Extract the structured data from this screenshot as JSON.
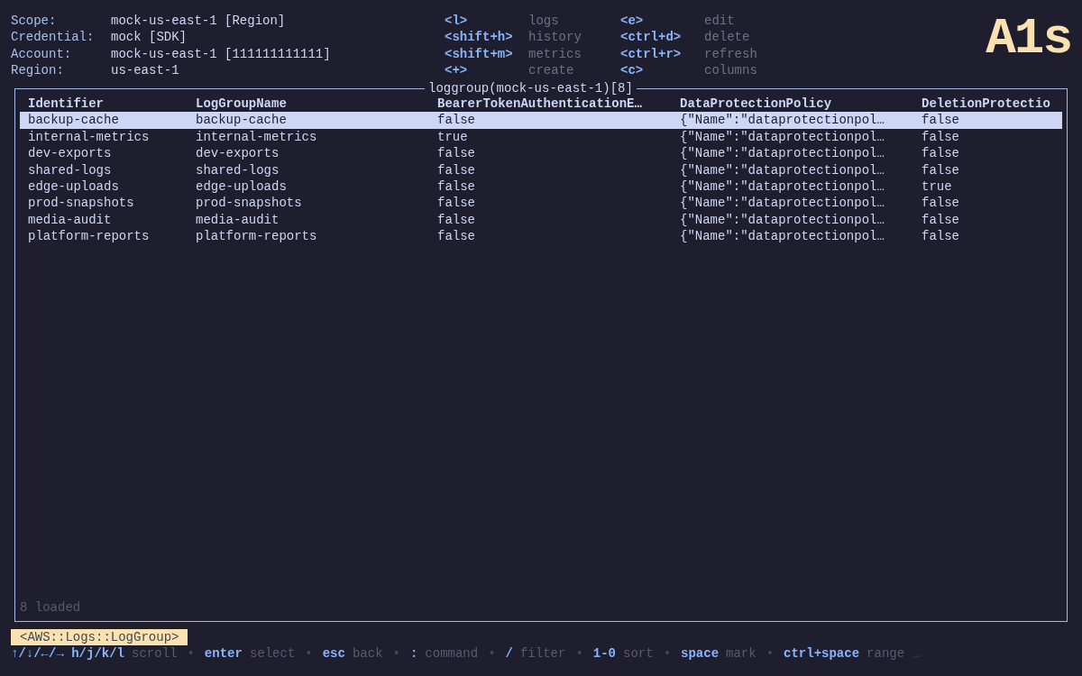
{
  "context": [
    {
      "label": "Scope:",
      "value": "mock-us-east-1 [Region]"
    },
    {
      "label": "Credential:",
      "value": "mock [SDK]"
    },
    {
      "label": "Account:",
      "value": "mock-us-east-1 [111111111111]"
    },
    {
      "label": "Region:",
      "value": "us-east-1"
    }
  ],
  "shortcuts": [
    {
      "key": "<l>",
      "action": "logs"
    },
    {
      "key": "<shift+h>",
      "action": "history"
    },
    {
      "key": "<shift+m>",
      "action": "metrics"
    },
    {
      "key": "<+>",
      "action": "create"
    },
    {
      "key": "<e>",
      "action": "edit"
    },
    {
      "key": "<ctrl+d>",
      "action": "delete"
    },
    {
      "key": "<ctrl+r>",
      "action": "refresh"
    },
    {
      "key": "<c>",
      "action": "columns"
    }
  ],
  "logo": "A1s",
  "table": {
    "title": "loggroup(mock-us-east-1)[8]",
    "columns": [
      "Identifier",
      "LogGroupName",
      "BearerTokenAuthenticationE…",
      "DataProtectionPolicy",
      "DeletionProtectio"
    ],
    "rows": [
      {
        "selected": true,
        "cells": [
          "backup-cache",
          "backup-cache",
          "false",
          "{\"Name\":\"dataprotectionpol…",
          "false"
        ]
      },
      {
        "selected": false,
        "cells": [
          "internal-metrics",
          "internal-metrics",
          "true",
          "{\"Name\":\"dataprotectionpol…",
          "false"
        ]
      },
      {
        "selected": false,
        "cells": [
          "dev-exports",
          "dev-exports",
          "false",
          "{\"Name\":\"dataprotectionpol…",
          "false"
        ]
      },
      {
        "selected": false,
        "cells": [
          "shared-logs",
          "shared-logs",
          "false",
          "{\"Name\":\"dataprotectionpol…",
          "false"
        ]
      },
      {
        "selected": false,
        "cells": [
          "edge-uploads",
          "edge-uploads",
          "false",
          "{\"Name\":\"dataprotectionpol…",
          "true"
        ]
      },
      {
        "selected": false,
        "cells": [
          "prod-snapshots",
          "prod-snapshots",
          "false",
          "{\"Name\":\"dataprotectionpol…",
          "false"
        ]
      },
      {
        "selected": false,
        "cells": [
          "media-audit",
          "media-audit",
          "false",
          "{\"Name\":\"dataprotectionpol…",
          "false"
        ]
      },
      {
        "selected": false,
        "cells": [
          "platform-reports",
          "platform-reports",
          "false",
          "{\"Name\":\"dataprotectionpol…",
          "false"
        ]
      }
    ],
    "status": "8 loaded"
  },
  "resource_tag": "<AWS::Logs::LogGroup>",
  "hints": [
    {
      "keys": "↑/↓/←/→ h/j/k/l",
      "action": "scroll"
    },
    {
      "separator": "•",
      "keys": "enter",
      "action": "select"
    },
    {
      "separator": "•",
      "keys": "esc",
      "action": "back"
    },
    {
      "separator": "•",
      "keys": ":",
      "action": "command"
    },
    {
      "separator": "•",
      "keys": "/",
      "action": "filter"
    },
    {
      "separator": "•",
      "keys": "1-0",
      "action": "sort"
    },
    {
      "separator": "•",
      "keys": "space",
      "action": "mark"
    },
    {
      "separator": "•",
      "keys": "ctrl+space",
      "action": "range"
    }
  ],
  "more": "…"
}
